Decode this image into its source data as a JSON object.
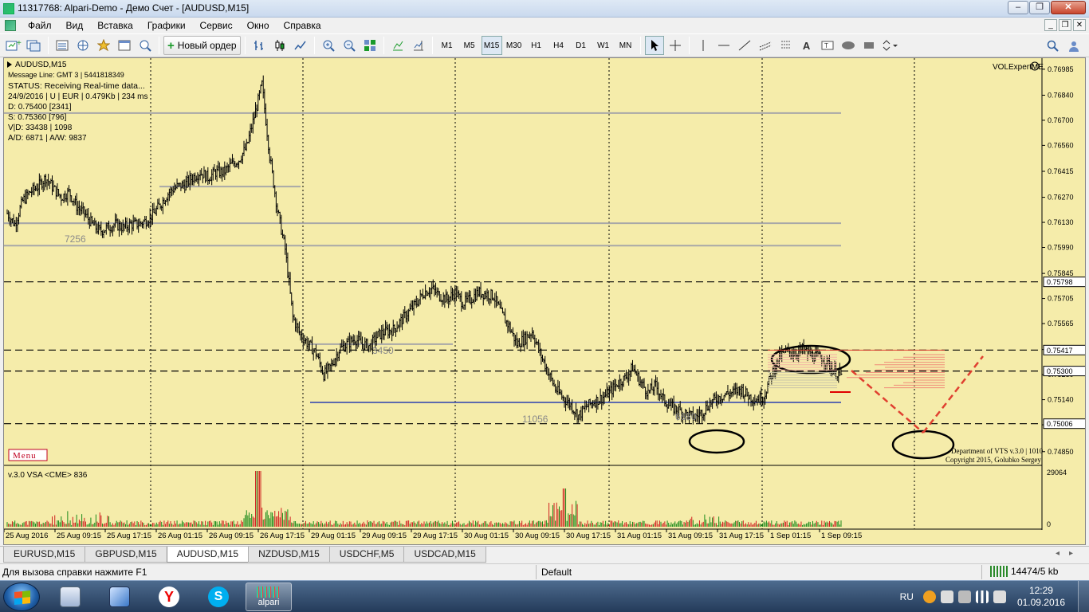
{
  "window": {
    "title": "11317768: Alpari-Demo - Демо Счет - [AUDUSD,M15]"
  },
  "menu": [
    "Файл",
    "Вид",
    "Вставка",
    "Графики",
    "Сервис",
    "Окно",
    "Справка"
  ],
  "toolbar": {
    "new_order_label": "Новый ордер",
    "timeframes": [
      "M1",
      "M5",
      "M15",
      "M30",
      "H1",
      "H4",
      "D1",
      "W1",
      "MN"
    ],
    "active_timeframe": "M15"
  },
  "chart": {
    "symbol_label": "AUDUSD,M15",
    "info_lines": [
      "Message Line: GMT 3 | 5441818349",
      "STATUS:  Receiving Real-time data...",
      "24/9/2016 | U | EUR | 0.479Kb | 234 ms",
      "D: 0.75400  [2341]",
      "S: 0.75360  [796]",
      "V|D: 33438 | 1098",
      "A/D: 6871 | A/W: 9837"
    ],
    "expert_name": "VOLExpertME",
    "menu_button": "Menu",
    "copyright_lines": [
      "Department of VTS  v.3.0 | 1010",
      "Copyright 2015, Golubko Sergey"
    ],
    "level_labels": [
      "7256",
      "3450",
      "11056",
      "6680"
    ],
    "indicator_label": "v.3.0 VSA <CME> 836",
    "indicator_axis": [
      "29064",
      "0"
    ],
    "colors": {
      "background": "#f5ecaa",
      "candles": "#000000",
      "grey_level": "#a8a8a8",
      "blue_level": "#2b3fb0",
      "red_projection": "#e04030",
      "volume_green": "#1a8a1a",
      "volume_red": "#d02020"
    }
  },
  "chart_data": {
    "type": "line",
    "title": "",
    "price_axis": [
      "0.76985",
      "0.76840",
      "0.76700",
      "0.76560",
      "0.76415",
      "0.76270",
      "0.76130",
      "0.75990",
      "0.75845",
      "0.75705",
      "0.75565",
      "0.75420",
      "0.75280",
      "0.75140",
      "0.75000",
      "0.74850"
    ],
    "price_labels_highlighted": [
      "0.75798",
      "0.75417",
      "0.75300",
      "0.75006"
    ],
    "time_axis": [
      "25 Aug 2016",
      "25 Aug 09:15",
      "25 Aug 17:15",
      "26 Aug 01:15",
      "26 Aug 09:15",
      "26 Aug 17:15",
      "29 Aug 01:15",
      "29 Aug 09:15",
      "29 Aug 17:15",
      "30 Aug 01:15",
      "30 Aug 09:15",
      "30 Aug 17:15",
      "31 Aug 01:15",
      "31 Aug 09:15",
      "31 Aug 17:15",
      "1 Sep 01:15",
      "1 Sep 09:15"
    ],
    "ylim": [
      0.748,
      0.7702
    ],
    "horizontal_levels": [
      0.75798,
      0.75417,
      0.753,
      0.75006
    ],
    "series": [
      {
        "values": [
          0.7618,
          0.7612,
          0.7625,
          0.763,
          0.7633,
          0.7638,
          0.7632,
          0.7627,
          0.763,
          0.7622,
          0.7618,
          0.7612,
          0.7608,
          0.761,
          0.7612,
          0.761,
          0.7612,
          0.7612,
          0.7614,
          0.7618,
          0.7624,
          0.763,
          0.7633,
          0.7634,
          0.7638,
          0.7641,
          0.7638,
          0.7641,
          0.7641,
          0.7645,
          0.7648,
          0.7655,
          0.7672,
          0.769,
          0.765,
          0.762,
          0.7598,
          0.756,
          0.755,
          0.7545,
          0.754,
          0.7528,
          0.7533,
          0.7542,
          0.7545,
          0.7548,
          0.7545,
          0.7544,
          0.755,
          0.7552,
          0.7553,
          0.7558,
          0.7563,
          0.7568,
          0.7574,
          0.7576,
          0.7572,
          0.757,
          0.7574,
          0.7568,
          0.757,
          0.7574,
          0.7573,
          0.7572,
          0.7562,
          0.7555,
          0.7545,
          0.7548,
          0.7552,
          0.754,
          0.753,
          0.752,
          0.7515,
          0.7511,
          0.7505,
          0.751,
          0.7513,
          0.7515,
          0.7518,
          0.7523,
          0.7526,
          0.7532,
          0.7524,
          0.7518,
          0.7522,
          0.7514,
          0.751,
          0.7508,
          0.7506,
          0.7504,
          0.7507,
          0.7512,
          0.7515,
          0.7517,
          0.7518,
          0.752,
          0.7516,
          0.7514,
          0.7516,
          0.7528,
          0.7538,
          0.7541,
          0.754,
          0.7542,
          0.7539,
          0.7538,
          0.7536,
          0.753,
          0.7528
        ]
      }
    ],
    "volume_note": "spikes near 26 Aug 17:15 and 30 Aug 09:15"
  },
  "tabs": [
    "EURUSD,M15",
    "GBPUSD,M15",
    "AUDUSD,M15",
    "NZDUSD,M15",
    "USDCHF,M5",
    "USDCAD,M15"
  ],
  "active_tab": "AUDUSD,M15",
  "status": {
    "help": "Для вызова справки нажмите F1",
    "profile": "Default",
    "connection": "14474/5 kb"
  },
  "taskbar": {
    "app_label": "alpari",
    "lang": "RU",
    "time": "12:29",
    "date": "01.09.2016"
  }
}
